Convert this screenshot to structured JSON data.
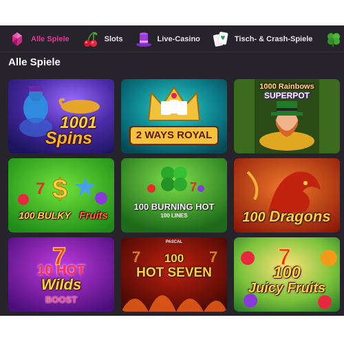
{
  "nav": {
    "items": [
      {
        "label": "Alle Spiele",
        "icon": "gem-icon",
        "active": true
      },
      {
        "label": "Slots",
        "icon": "cherries-icon",
        "active": false
      },
      {
        "label": "Live-Casino",
        "icon": "top-hat-icon",
        "active": false
      },
      {
        "label": "Tisch- & Crash-Spiele",
        "icon": "playing-cards-icon",
        "active": false
      },
      {
        "label": "",
        "icon": "clover-icon",
        "active": false
      }
    ],
    "active_color": "#e6349a"
  },
  "section": {
    "title": "Alle Spiele"
  },
  "games": [
    {
      "title_line1": "1001",
      "title_line2": "Spins",
      "subtitle": "",
      "theme": "lamp-genie"
    },
    {
      "title_line1": "2 WAYS ROYAL",
      "title_line2": "",
      "subtitle": "",
      "theme": "crown-cards"
    },
    {
      "title_line1": "1000 Rainbows",
      "title_line2": "SUPERPOT",
      "subtitle": "",
      "theme": "leprechaun"
    },
    {
      "title_line1": "100 BULKY",
      "title_line2": "Fruits",
      "subtitle": "",
      "theme": "fruits-sevens"
    },
    {
      "title_line1": "100 BURNING HOT",
      "title_line2": "",
      "subtitle": "100 LINES",
      "theme": "clover-fruits"
    },
    {
      "title_line1": "100",
      "title_line2": "Dragons",
      "subtitle": "",
      "theme": "dragon"
    },
    {
      "title_line1": "10 HOT",
      "title_line2": "Wilds",
      "subtitle": "BOOST",
      "theme": "purple-seven"
    },
    {
      "title_line1": "100",
      "title_line2": "HOT SEVEN",
      "subtitle": "PASCAL",
      "theme": "fire-seven"
    },
    {
      "title_line1": "100",
      "title_line2": "Juicy Fruits",
      "subtitle": "",
      "theme": "juicy-fruits"
    }
  ]
}
